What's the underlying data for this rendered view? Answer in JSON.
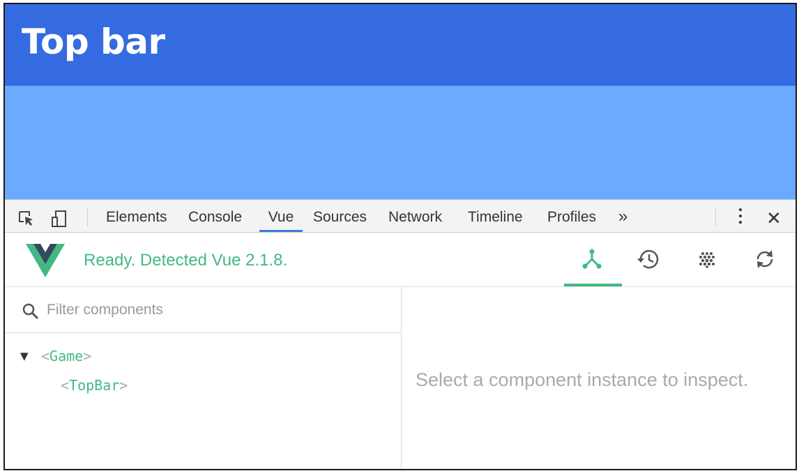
{
  "app": {
    "topbar_title": "Top bar",
    "colors": {
      "topbar": "#356be0",
      "body": "#6baaff"
    }
  },
  "devtools": {
    "tabs": [
      {
        "label": "Elements",
        "active": false
      },
      {
        "label": "Console",
        "active": false
      },
      {
        "label": "Vue",
        "active": true
      },
      {
        "label": "Sources",
        "active": false
      },
      {
        "label": "Network",
        "active": false
      },
      {
        "label": "Timeline",
        "active": false
      },
      {
        "label": "Profiles",
        "active": false
      }
    ],
    "more_label": "»",
    "close_label": "✕",
    "icons": [
      "inspect-element-icon",
      "device-toolbar-icon",
      "kebab-menu-icon",
      "close-icon"
    ]
  },
  "vue": {
    "status": "Ready. Detected Vue 2.1.8.",
    "accent": "#42b983",
    "nav": [
      "components-tree-icon",
      "history-icon",
      "vuex-icon",
      "refresh-icon"
    ],
    "active_nav": "components-tree-icon"
  },
  "components": {
    "filter_placeholder": "Filter components",
    "tree": [
      {
        "open": "<",
        "name": "Game",
        "close": ">",
        "expanded": true
      },
      {
        "open": "<",
        "name": "TopBar",
        "close": ">"
      }
    ]
  },
  "inspector": {
    "empty_message": "Select a component instance to inspect."
  }
}
